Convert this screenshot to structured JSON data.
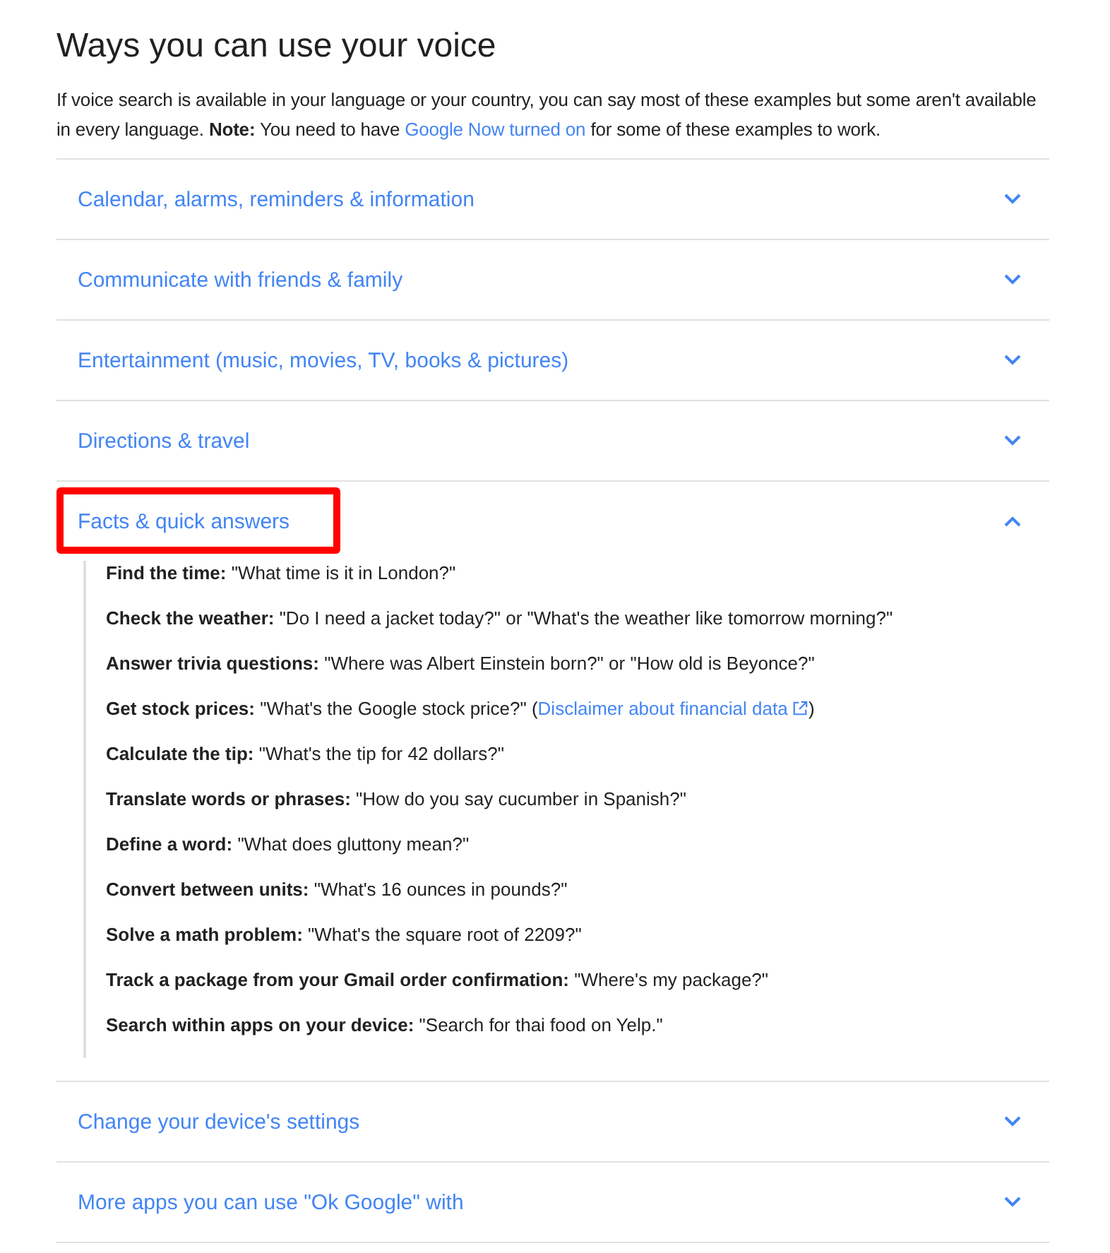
{
  "title": "Ways you can use your voice",
  "intro": {
    "text": "If voice search is available in your language or your country, you can say most of these examples but some aren't available in every language.  **Note:** You need to have",
    "link": "Google Now turned on",
    "text_after": "for some of these examples to work."
  },
  "sections": [
    {
      "label": "Calendar, alarms, reminders & information",
      "expanded": false,
      "highlighted": false
    },
    {
      "label": "Communicate with friends & family",
      "expanded": false,
      "highlighted": false
    },
    {
      "label": "Entertainment (music, movies, TV, books & pictures)",
      "expanded": false,
      "highlighted": false
    },
    {
      "label": "Directions & travel",
      "expanded": false,
      "highlighted": false
    },
    {
      "label": "Facts & quick answers",
      "expanded": true,
      "highlighted": true,
      "items": [
        {
          "text": "**Find the time:** \"What time is it in London?\""
        },
        {
          "text": "**Check the weather:** \"Do I need a jacket today?\" or \"What's the weather like tomorrow morning?\""
        },
        {
          "text": "**Answer trivia questions:** \"Where was Albert Einstein born?\" or \"How old is Beyonce?\""
        },
        {
          "text": "**Get stock prices:** \"What's the Google stock price?\" (",
          "link": "Disclaimer about financial data",
          "text_after": ")"
        },
        {
          "text": "**Calculate the tip:** \"What's the tip for 42 dollars?\""
        },
        {
          "text": "**Translate words or phrases:** \"How do you say cucumber in Spanish?\""
        },
        {
          "text": "**Define a word:** \"What does gluttony mean?\""
        },
        {
          "text": "**Convert between units:** \"What's 16 ounces in pounds?\""
        },
        {
          "text": "**Solve a math problem:** \"What's the square root of 2209?\""
        },
        {
          "text": "**Track a package from your Gmail order confirmation:** \"Where's my package?\""
        },
        {
          "text": "**Search within apps on your device:** \"Search for thai food on Yelp.\""
        }
      ]
    },
    {
      "label": "Change your device's settings",
      "expanded": false,
      "highlighted": false
    },
    {
      "label": "More apps you can use \"Ok Google\" with",
      "expanded": false,
      "highlighted": false
    }
  ]
}
